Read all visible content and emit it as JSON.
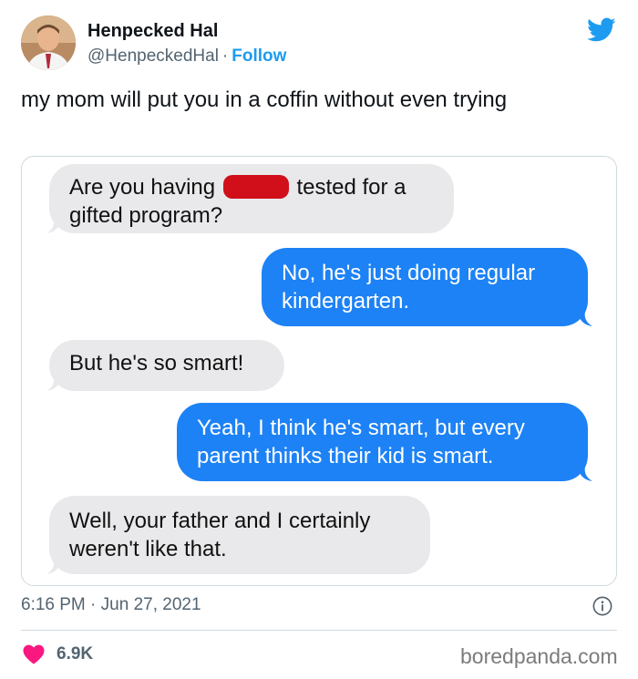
{
  "author": {
    "name": "Henpecked Hal",
    "handle": "@HenpeckedHal",
    "separator": "·",
    "follow_label": "Follow",
    "avatar_icon": "person-avatar"
  },
  "tweet": {
    "text": "my mom will put you in a coffin without even trying"
  },
  "messages": [
    {
      "direction": "in",
      "text_before": "Are you having ",
      "redacted": true,
      "text_after": " tested for a gifted program?"
    },
    {
      "direction": "out",
      "text": "No, he's just doing regular kindergarten."
    },
    {
      "direction": "in",
      "text": "But he's so smart!"
    },
    {
      "direction": "out",
      "text": "Yeah, I think he's smart, but every parent thinks their kid is smart."
    },
    {
      "direction": "in",
      "text": "Well, your father and I certainly weren't like that."
    }
  ],
  "footer": {
    "time": "6:16 PM",
    "separator": "·",
    "date": "Jun 27, 2021",
    "likes": "6.9K",
    "watermark": "boredpanda.com"
  },
  "colors": {
    "twitter_blue": "#1d9bf0",
    "incoming_bubble": "#e9e9eb",
    "outgoing_bubble": "#1d82f5",
    "heart": "#f91880",
    "redaction": "#d10f1b"
  },
  "icons": {
    "bird": "twitter-bird-icon",
    "info": "info-icon",
    "heart": "heart-icon"
  }
}
